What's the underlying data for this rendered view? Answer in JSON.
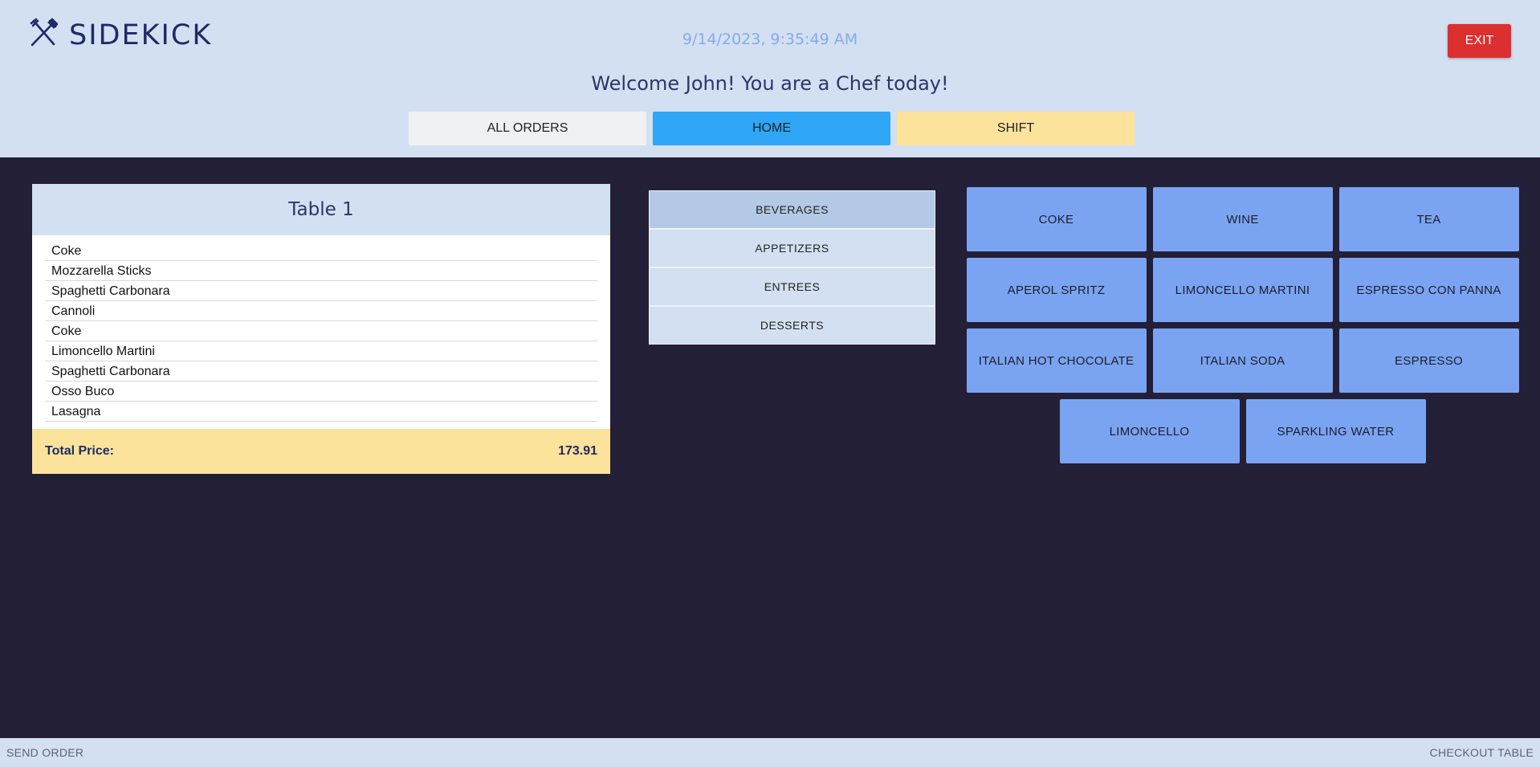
{
  "header": {
    "app_name": "SIDEKICK",
    "datetime": "9/14/2023, 9:35:49 AM",
    "exit_label": "EXIT",
    "welcome": "Welcome John! You are a Chef today!",
    "nav": [
      "ALL ORDERS",
      "HOME",
      "SHIFT"
    ]
  },
  "order": {
    "table_title": "Table 1",
    "items": [
      "Coke",
      "Mozzarella Sticks",
      "Spaghetti Carbonara",
      "Cannoli",
      "Coke",
      "Limoncello Martini",
      "Spaghetti Carbonara",
      "Osso Buco",
      "Lasagna"
    ],
    "total_label": "Total Price:",
    "total_value": "173.91"
  },
  "categories": [
    "BEVERAGES",
    "APPETIZERS",
    "ENTREES",
    "DESSERTS"
  ],
  "menu_items": [
    "COKE",
    "WINE",
    "TEA",
    "APEROL SPRITZ",
    "LIMONCELLO MARTINI",
    "ESPRESSO CON PANNA",
    "ITALIAN HOT CHOCOLATE",
    "ITALIAN SODA",
    "ESPRESSO",
    "LIMONCELLO",
    "SPARKLING WATER"
  ],
  "footer": {
    "send_order": "SEND ORDER",
    "checkout": "CHECKOUT TABLE"
  },
  "colors": {
    "header_bg": "#d3e0f1",
    "body_bg": "#221f36",
    "exit": "#dc2f2f",
    "home_tab": "#2fa6f6",
    "shift_tab": "#fce39c",
    "item_button": "#7aa4f2"
  }
}
